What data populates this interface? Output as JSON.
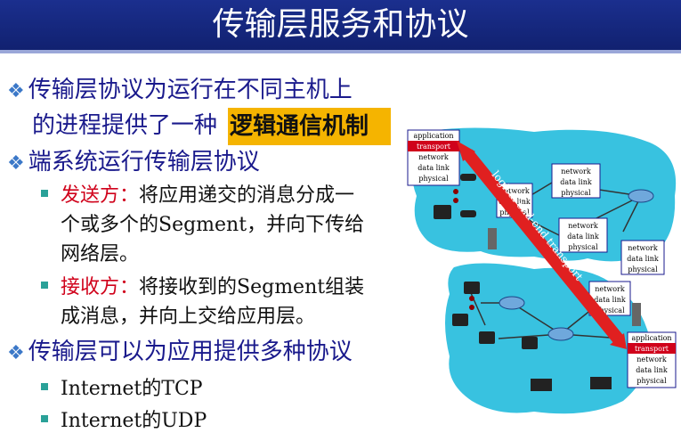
{
  "title": "传输层服务和协议",
  "bullets": {
    "b1_line1": "传输层协议为运行在不同主机上",
    "b1_line2_pre": "的进程提供了一种",
    "b1_highlight": "逻辑通信机制",
    "b2": "端系统运行传输层协议",
    "sender_label": "发送方：",
    "sender_text_1": "将应用递交的消息分成一",
    "sender_text_2": "个或多个的Segment，并向下传给",
    "sender_text_3": "网络层。",
    "receiver_label": "接收方：",
    "receiver_text_1": "将接收到的Segment组装",
    "receiver_text_2": "成消息，并向上交给应用层。",
    "b3": "传输层可以为应用提供多种协议",
    "sub1": "Internet的TCP",
    "sub2": "Internet的UDP"
  },
  "figure": {
    "arrow_label": "logical end-end transport",
    "stack_full": [
      "application",
      "transport",
      "network",
      "data link",
      "physical"
    ],
    "stack_net": [
      "network",
      "data link",
      "physical"
    ],
    "colors": {
      "cloud": "#38c2e0",
      "arrow": "#e02020",
      "transport_bg": "#d0021b",
      "highlight": "#f5b400"
    }
  }
}
